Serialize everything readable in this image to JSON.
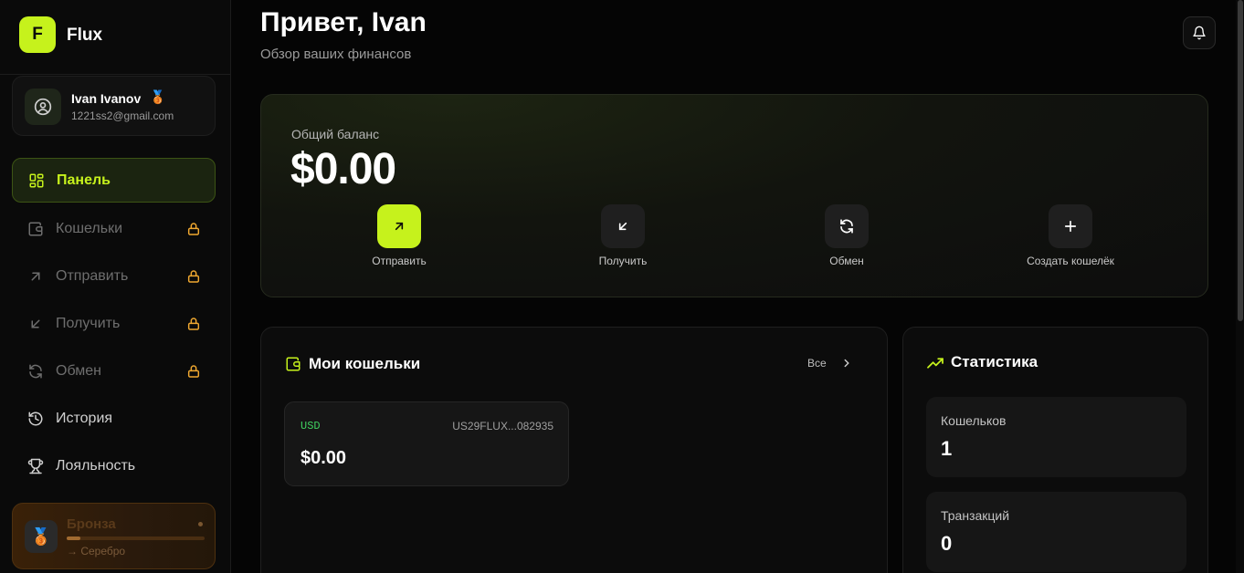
{
  "brand": {
    "logo_letter": "F",
    "name": "Flux"
  },
  "user": {
    "name": "Ivan Ivanov",
    "badge": "🥉",
    "email": "1221ss2@gmail.com"
  },
  "nav": [
    {
      "label": "Панель",
      "icon": "dashboard-icon",
      "state": "active"
    },
    {
      "label": "Кошельки",
      "icon": "wallet-icon",
      "state": "locked"
    },
    {
      "label": "Отправить",
      "icon": "arrow-up-right-icon",
      "state": "locked"
    },
    {
      "label": "Получить",
      "icon": "arrow-down-left-icon",
      "state": "locked"
    },
    {
      "label": "Обмен",
      "icon": "refresh-icon",
      "state": "locked"
    },
    {
      "label": "История",
      "icon": "history-icon",
      "state": "normal"
    },
    {
      "label": "Лояльность",
      "icon": "trophy-icon",
      "state": "normal"
    }
  ],
  "loyalty": {
    "tier": "Бронза",
    "medal": "🥉",
    "next": "→ Серебро",
    "progress_percent": 10
  },
  "header": {
    "title": "Привет, Ivan",
    "subtitle": "Обзор ваших финансов"
  },
  "balance": {
    "label": "Общий баланс",
    "value": "$0.00",
    "actions": [
      {
        "label": "Отправить",
        "icon": "arrow-up-right-icon",
        "primary": true
      },
      {
        "label": "Получить",
        "icon": "arrow-down-left-icon",
        "primary": false
      },
      {
        "label": "Обмен",
        "icon": "refresh-icon",
        "primary": false
      },
      {
        "label": "Создать кошелёк",
        "icon": "plus-icon",
        "primary": false
      }
    ]
  },
  "wallets": {
    "title": "Мои кошельки",
    "see_all": "Все",
    "items": [
      {
        "currency": "USD",
        "iban": "US29FLUX...082935",
        "balance": "$0.00"
      }
    ]
  },
  "stats": {
    "title": "Статистика",
    "items": [
      {
        "label": "Кошельков",
        "value": "1"
      },
      {
        "label": "Транзакций",
        "value": "0"
      }
    ]
  },
  "colors": {
    "accent": "#c6f21c",
    "background": "#050505",
    "locked": "#f0a830",
    "currency": "#3fcf5f"
  }
}
